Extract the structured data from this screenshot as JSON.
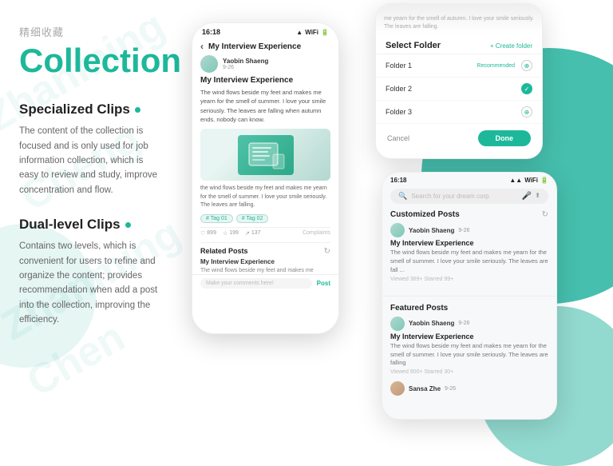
{
  "left": {
    "chinese_title": "精细收藏",
    "main_title": "Collection",
    "section1": {
      "title": "Specialized Clips",
      "desc": "The content of the collection is focused and is only used for job information collection, which is easy to review and study, improve concentration and flow."
    },
    "section2": {
      "title": "Dual-level Clips",
      "desc": "Contains two levels, which is convenient for users to refine and organize the content; provides recommendation when add a post into the collection, improving the efficiency."
    }
  },
  "phone1": {
    "time": "16:18",
    "nav_title": "My Interview Experience",
    "author_name": "Yaobin Shaeng",
    "author_date": "9-26",
    "article_title": "My Interview Experience",
    "article_text": "The wind flows beside my feet and makes me yearn for the smell of summer. I love your smile seriously. The leaves are falling when autumn ends. nobody can know.",
    "article_text2": "the wind flows beside my feet and makes me yearn for the smell of summer. I love your smile seriously. The leaves are falling.",
    "tag1": "# Tag 01",
    "tag2": "# Tag 02",
    "likes": "899",
    "stars": "199",
    "shares": "137",
    "complaints": "Complaints",
    "related_title": "Related Posts",
    "related_item_title": "My Interview Experience",
    "related_item_text": "The wind flows beside my feet and makes me",
    "comment_placeholder": "Make your comments here!",
    "post_label": "Post"
  },
  "phone2": {
    "blur_text": "me yearn for the smell of autumn. I love your smile seriously. The leaves are falling.",
    "header_title": "Select Folder",
    "create_label": "+ Create folder",
    "folder1": "Folder 1",
    "folder1_badge": "Recommended",
    "folder2": "Folder 2",
    "folder3": "Folder 3",
    "cancel_label": "Cancel",
    "done_label": "Done"
  },
  "phone3": {
    "time": "16:18",
    "search_placeholder": "Search for your dream corp",
    "section1_title": "Customized Posts",
    "post1_author": "Yaobin Shaeng",
    "post1_date": "9-26",
    "post1_title": "My Interview Experience",
    "post1_text": "The wind flows beside my feet and makes me yearn for the smell of summer. I love your smile seriously. The leaves are fall ...",
    "post1_stats": "Viewed 369+  Starred 99+",
    "section2_title": "Featured Posts",
    "post2_author": "Yaobin Shaeng",
    "post2_date": "9-26",
    "post2_title": "My Interview Experience",
    "post2_text": "The wind flows beside my feet and makes me yearn for the smell of summer. I love your smile seriously. The leaves are falling",
    "post2_stats": "Viewed 900+  Starred 30+",
    "post3_author": "Sansa Zhe",
    "post3_date": "9-26"
  },
  "colors": {
    "teal": "#1db89a",
    "teal_light": "#e8f5f2",
    "text_dark": "#222222",
    "text_mid": "#666666",
    "text_light": "#999999"
  }
}
